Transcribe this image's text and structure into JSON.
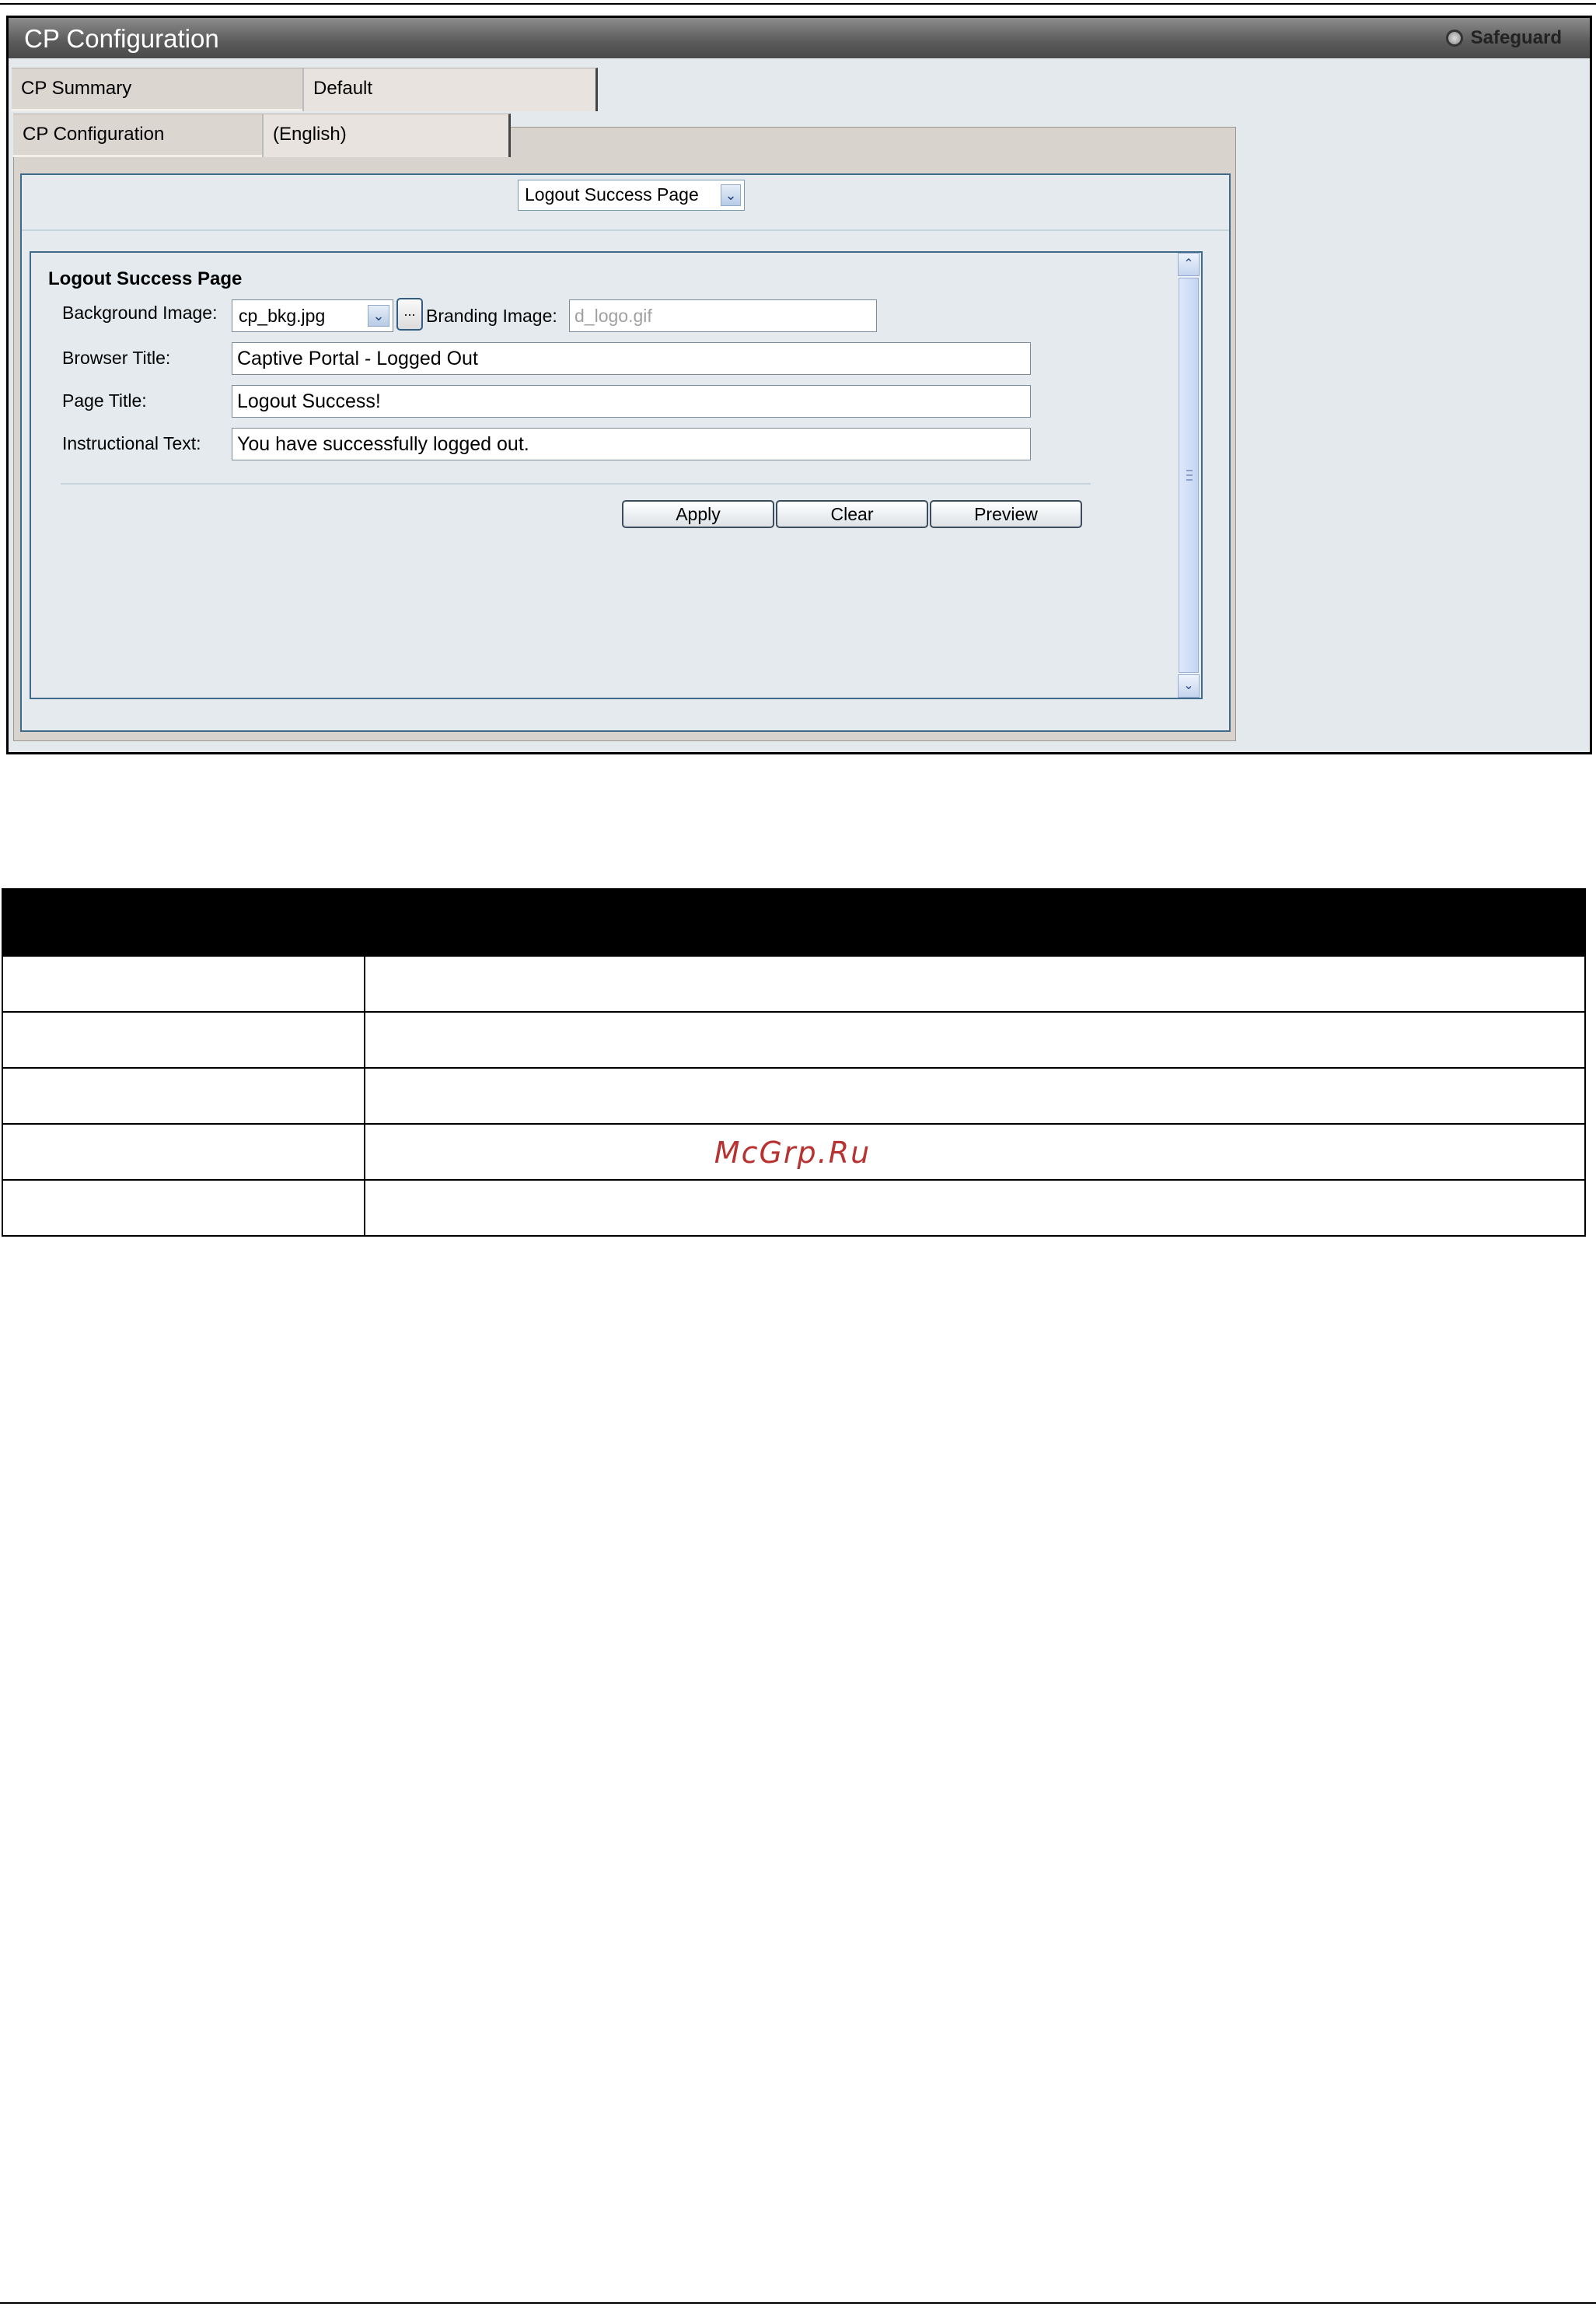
{
  "window": {
    "title": "CP Configuration",
    "brand": "Safeguard",
    "brand_icon": "safeguard-circle-icon"
  },
  "tabs": {
    "row1": {
      "label": "CP Summary",
      "value": "Default"
    },
    "row2": {
      "label": "CP Configuration",
      "value": "(English)"
    }
  },
  "page_select": {
    "selected": "Logout Success Page",
    "icon": "chevron-down-icon"
  },
  "form": {
    "heading": "Logout Success Page",
    "background_image_label": "Background Image:",
    "background_image_value": "cp_bkg.jpg",
    "browse_label": "...",
    "branding_image_label": "Branding Image:",
    "branding_image_value": "d_logo.gif",
    "browser_title_label": "Browser Title:",
    "browser_title_value": "Captive Portal - Logged Out",
    "page_title_label": "Page Title:",
    "page_title_value": "Logout Success!",
    "instructional_text_label": "Instructional Text:",
    "instructional_text_value": "You have successfully logged out."
  },
  "buttons": {
    "apply": "Apply",
    "clear": "Clear",
    "preview": "Preview"
  },
  "scrollbar": {
    "up_icon": "chevron-up-icon",
    "down_icon": "chevron-down-icon"
  },
  "reference_table": {
    "header": [
      "",
      ""
    ],
    "rows": [
      [
        "",
        ""
      ],
      [
        "",
        ""
      ],
      [
        "",
        ""
      ],
      [
        "",
        ""
      ],
      [
        "",
        ""
      ]
    ]
  },
  "watermark": "McGrp.Ru"
}
